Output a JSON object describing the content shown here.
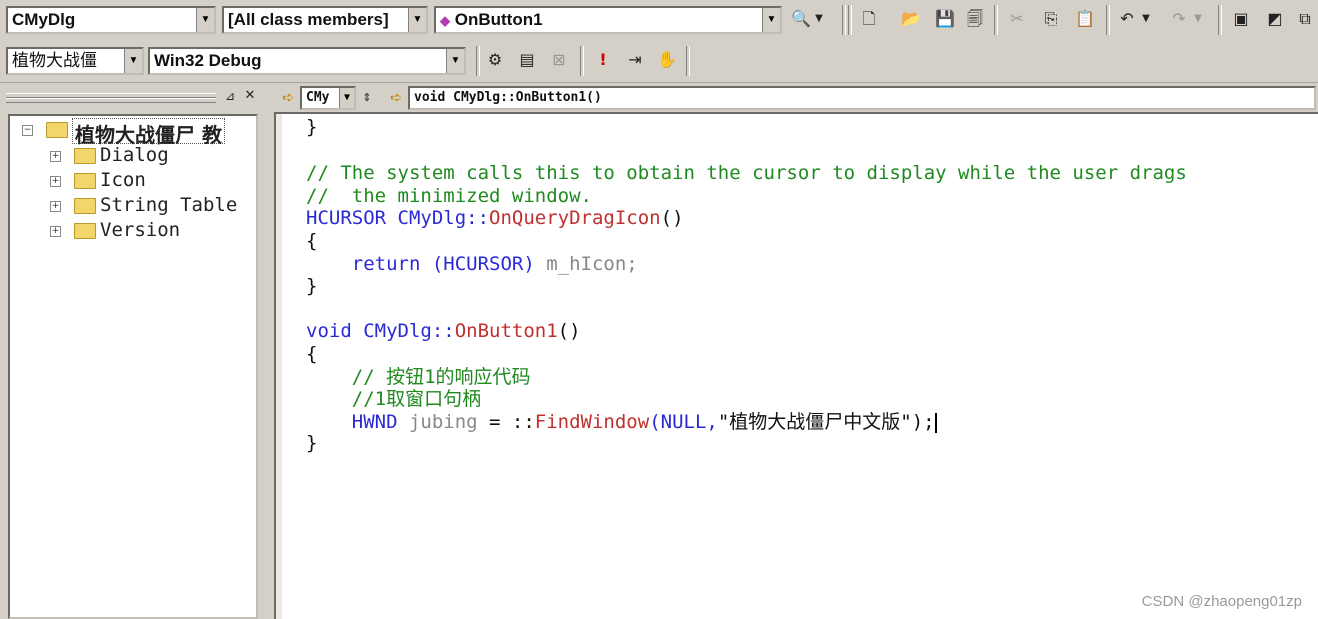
{
  "toolbar1": {
    "class_combo": "CMyDlg",
    "filter_combo": "[All class members]",
    "member_combo": "OnButton1"
  },
  "toolbar2": {
    "project_combo": "植物大战僵",
    "config_combo": "Win32 Debug"
  },
  "editor_bar": {
    "class_mini": "CMy",
    "signature": "void CMyDlg::OnButton1()"
  },
  "tree": {
    "root": "植物大战僵尸 教",
    "items": [
      {
        "label": "Dialog"
      },
      {
        "label": "Icon"
      },
      {
        "label": "String Table"
      },
      {
        "label": "Version"
      }
    ]
  },
  "code": {
    "l1": "}",
    "l2": "// The system calls this to obtain the cursor to display while the user drags",
    "l3": "//  the minimized window.",
    "l4a": "HCURSOR CMyDlg::",
    "l4b": "OnQueryDragIcon",
    "l4c": "()",
    "l5": "{",
    "l6a": "    return ",
    "l6b": "(HCURSOR) ",
    "l6c": "m_hIcon;",
    "l7": "}",
    "l8a": "void ",
    "l8b": "CMyDlg::",
    "l8c": "OnButton1",
    "l8d": "()",
    "l9": "{",
    "l10": "    // 按钮1的响应代码",
    "l11": "    //1取窗口句柄",
    "l12a": "    HWND ",
    "l12b": "jubing",
    "l12c": " = ::",
    "l12d": "FindWindow",
    "l12e": "(NULL,",
    "l12f": "\"植物大战僵尸中文版\");",
    "l13": "}"
  },
  "watermark": "CSDN @zhaopeng01zp",
  "colors": {
    "comment": "#1f8a1f",
    "keyword": "#2a2ad4",
    "function": "#c03030",
    "background": "#d4d0c8"
  }
}
